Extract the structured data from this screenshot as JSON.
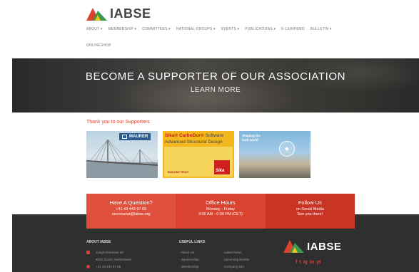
{
  "brand": {
    "name": "IABSE"
  },
  "nav": {
    "items": [
      "About ▾",
      "Membership ▾",
      "Committees ▾",
      "National Groups ▾",
      "Events ▾",
      "Publications ▾",
      "E-Learning",
      "Bulletin ▾"
    ],
    "row2": "Onlineshop"
  },
  "hero": {
    "title": "BECOME A SUPPORTER OF OUR ASSOCIATION",
    "subtitle": "LEARN MORE"
  },
  "supporters": {
    "heading": "Thank you to our Supporters",
    "maurer": {
      "badge": "MAURER"
    },
    "sika": {
      "line1_brand": "Sika® CarboDur®",
      "line1_rest": " Software",
      "line2": "Advanced Structural Design",
      "trust": "Building Trust",
      "logo": "Sika"
    },
    "shaping": {
      "text": "Shaping the built world"
    }
  },
  "info_bar": [
    {
      "heading": "Have A Question?",
      "lines": [
        "+41 43 443 97 65",
        "secretariat@iabse.org"
      ]
    },
    {
      "heading": "Office Hours",
      "lines": [
        "Monday - Friday",
        "9:00 AM - 6:00 PM (CET)"
      ]
    },
    {
      "heading": "Follow Us",
      "lines": [
        "on Social Media",
        "See you there!"
      ]
    }
  ],
  "footer": {
    "about_title": "About IABSE",
    "about_rows": [
      "Jungholzstrasse 28",
      "8050 Zurich, Switzerland",
      "+41 43 443 97 65"
    ],
    "links_title": "Useful Links",
    "links": [
      "About Us",
      "Latest News",
      "Sponsorship",
      "Upcoming Events",
      "Membership",
      "Company Info"
    ],
    "logo_text": "IABSE",
    "social": [
      "f",
      "t",
      "ig",
      "in",
      "yt"
    ]
  },
  "colors": {
    "accent": "#d9432f",
    "footer_bg": "#2f2f2f"
  }
}
